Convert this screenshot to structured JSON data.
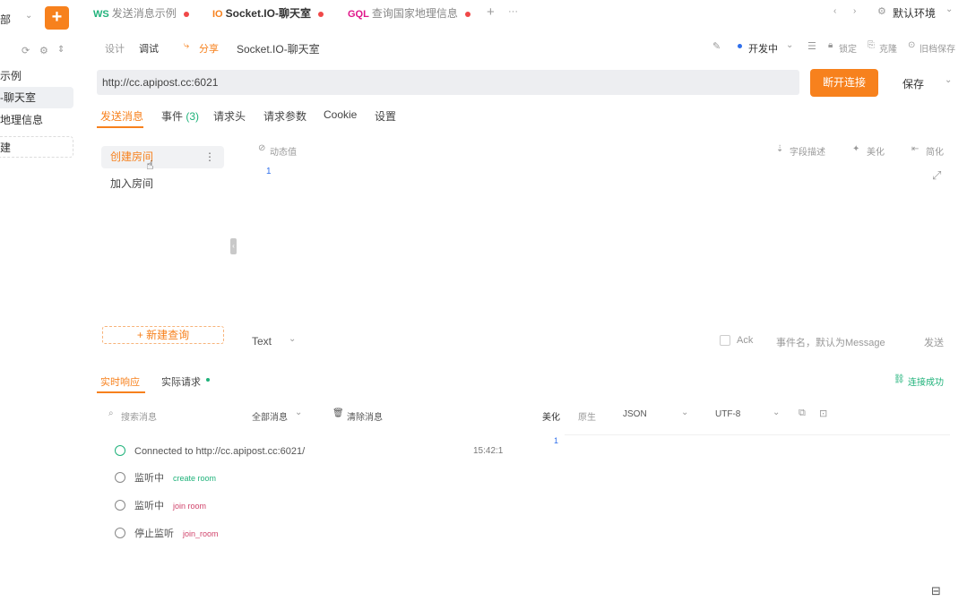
{
  "sidebar": {
    "add_label": "+",
    "partial_top": "部",
    "items": [
      {
        "label": "示例",
        "active": false
      },
      {
        "label": "-聊天室",
        "active": true
      },
      {
        "label": "地理信息",
        "active": false
      },
      {
        "label": "建",
        "active": false
      }
    ]
  },
  "tabs": [
    {
      "proto": "WS",
      "label": "发送消息示例",
      "color": "#1fb27a"
    },
    {
      "proto": "IO",
      "label": "Socket.IO-聊天室",
      "color": "#f7811d",
      "active": true
    },
    {
      "proto": "GQL",
      "label": "查询国家地理信息",
      "color": "#e0168a"
    }
  ],
  "tabbar": {
    "add": "+",
    "more": "···",
    "env_label": "默认环境"
  },
  "toolbar": {
    "design": "设计",
    "debug": "调试",
    "share": "分享",
    "title": "Socket.IO-聊天室",
    "status": "开发中",
    "lock": "锁定",
    "clone": "克隆",
    "save_old": "旧档保存"
  },
  "url": {
    "value": "http://cc.apipost.cc:6021",
    "disconnect_label": "断开连接",
    "save_label": "保存"
  },
  "subtabs": {
    "send": "发送消息",
    "events": "事件",
    "events_count": "(3)",
    "headers": "请求头",
    "params": "请求参数",
    "cookie": "Cookie",
    "settings": "设置"
  },
  "messages": {
    "items": [
      "创建房间",
      "加入房间"
    ],
    "new_query": "+ 新建查询",
    "dynamic_value": "动态值",
    "field_desc": "字段描述",
    "beautify": "美化",
    "simplify": "简化",
    "editor_line": "1"
  },
  "send_bar": {
    "format": "Text",
    "ack": "Ack",
    "event_placeholder": "事件名，默认为Message",
    "send_label": "发送"
  },
  "response": {
    "tab_realtime": "实时响应",
    "tab_request": "实际请求",
    "connected_status": "连接成功",
    "search_placeholder": "搜索消息",
    "filter": "全部消息",
    "clear": "清除消息",
    "beautify": "美化",
    "raw": "原生",
    "format": "JSON",
    "encoding": "UTF-8",
    "line_no": "1",
    "logs": [
      {
        "type": "ok",
        "text": "Connected to http://cc.apipost.cc:6021/",
        "tag": "",
        "time": "15:42:1"
      },
      {
        "type": "info",
        "text": "监听中",
        "tag": "create room",
        "tagclass": "g"
      },
      {
        "type": "info",
        "text": "监听中",
        "tag": "join room",
        "tagclass": "r"
      },
      {
        "type": "info",
        "text": "停止监听",
        "tag": "join_room",
        "tagclass": "r"
      }
    ]
  }
}
